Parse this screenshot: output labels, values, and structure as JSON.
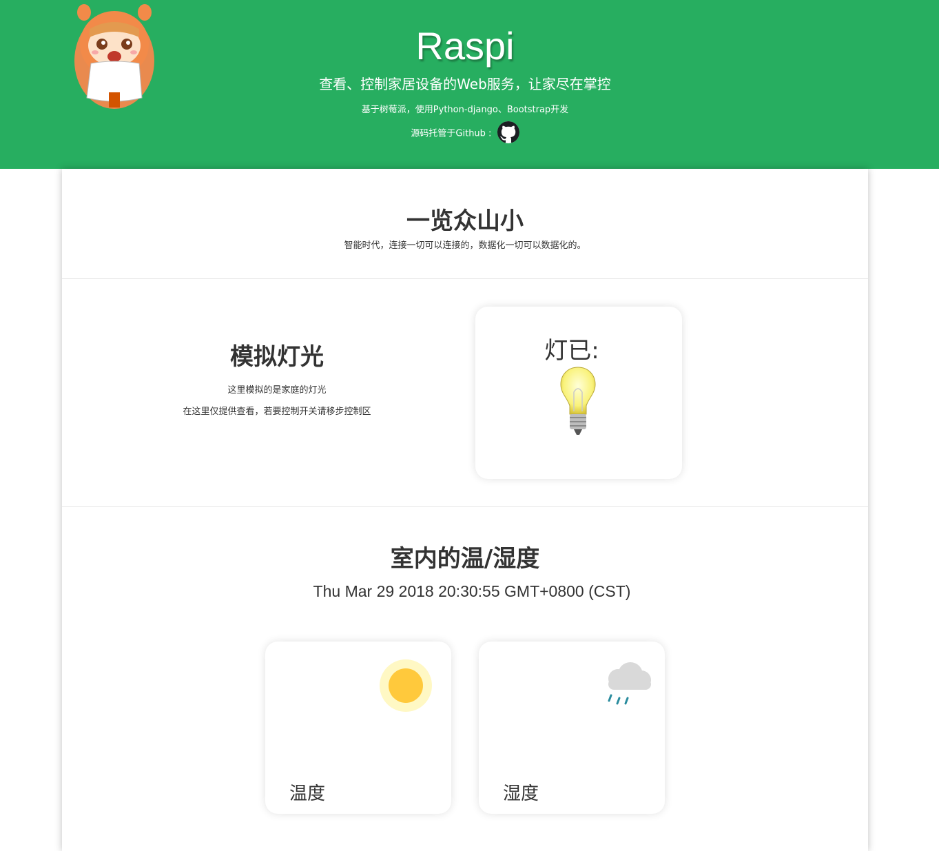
{
  "header": {
    "title": "Raspi",
    "subtitle": "查看、控制家居设备的Web服务，让家尽在掌控",
    "tech": "基于树莓派，使用Python-django、Bootstrap开发",
    "source": "源码托管于Github :",
    "avatar_icon": "anime-character-avatar",
    "github_icon": "github-icon",
    "background_color": "#27ae60"
  },
  "overview": {
    "title": "一览众山小",
    "subtitle": "智能时代，连接一切可以连接的，数据化一切可以数据化的。"
  },
  "light": {
    "title": "模拟灯光",
    "line1": "这里模拟的是家庭的灯光",
    "line2": "在这里仅提供查看，若要控制开关请移步控制区",
    "status": "灯已:",
    "icon": "light-bulb-icon"
  },
  "climate": {
    "title": "室内的温/湿度",
    "datetime": "Thu Mar 29 2018 20:30:55 GMT+0800 (CST)",
    "temperature_label": "温度",
    "humidity_label": "湿度",
    "temperature_icon": "sun-icon",
    "humidity_icon": "rain-cloud-icon"
  }
}
